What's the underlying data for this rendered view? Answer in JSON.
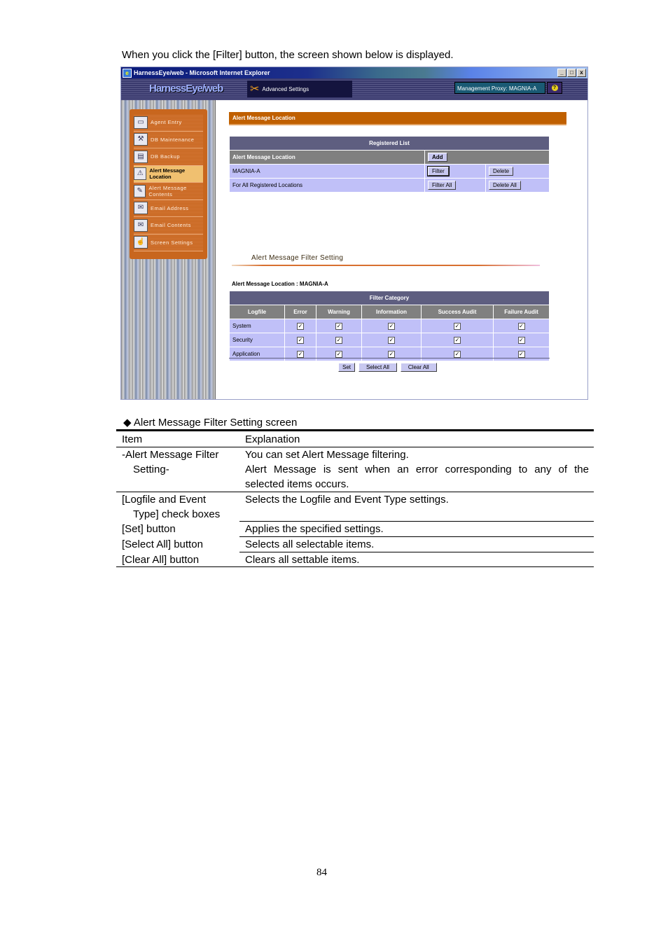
{
  "intro_text": "When you click the [Filter] button, the screen shown below is displayed.",
  "browser": {
    "title": "HarnessEye/web - Microsoft Internet Explorer",
    "window_buttons": [
      "_",
      "□",
      "x"
    ]
  },
  "app": {
    "logo": "HarnessEye/web",
    "mode_label": "Advanced Settings",
    "proxy_label": "Management Proxy: MAGNIA-A",
    "help_icon": "?"
  },
  "sidebar": {
    "items": [
      {
        "label": "Agent Entry",
        "icon": "agent-entry-icon",
        "active": false
      },
      {
        "label": "DB Maintenance",
        "icon": "db-maintenance-icon",
        "active": false
      },
      {
        "label": "DB Backup",
        "icon": "db-backup-icon",
        "active": false
      },
      {
        "label": "Alert Message Location",
        "icon": "alert-warning-icon",
        "active": true
      },
      {
        "label": "Alert Message Contents",
        "icon": "alert-contents-icon",
        "active": false
      },
      {
        "label": "Email Address",
        "icon": "email-address-icon",
        "active": false
      },
      {
        "label": "Email Contents",
        "icon": "email-contents-icon",
        "active": false
      },
      {
        "label": "Screen Settings",
        "icon": "screen-settings-icon",
        "active": false
      }
    ]
  },
  "main": {
    "section_title": "Alert Message Location",
    "registered_list": {
      "title": "Registered List",
      "header_label": "Alert Message Location",
      "add_button": "Add",
      "rows": [
        {
          "name": "MAGNIA-A",
          "filter_button": "Filter",
          "delete_button": "Delete"
        },
        {
          "name": "For All Registered Locations",
          "filter_button": "Filter All",
          "delete_button": "Delete All"
        }
      ]
    },
    "filter_setting": {
      "title": "Alert Message Filter Setting",
      "location_label": "Alert Message Location : MAGNIA-A",
      "category_title": "Filter Category",
      "columns": [
        "Logfile",
        "Error",
        "Warning",
        "Information",
        "Success Audit",
        "Failure Audit"
      ],
      "rows": [
        {
          "logfile": "System",
          "checked": [
            true,
            true,
            true,
            true,
            true
          ]
        },
        {
          "logfile": "Security",
          "checked": [
            true,
            true,
            true,
            true,
            true
          ]
        },
        {
          "logfile": "Application",
          "checked": [
            true,
            true,
            true,
            true,
            true
          ]
        }
      ],
      "buttons": {
        "set": "Set",
        "select_all": "Select All",
        "clear_all": "Clear All"
      }
    }
  },
  "doc": {
    "caption": "◆ Alert Message Filter Setting screen",
    "headers": {
      "item": "Item",
      "explanation": "Explanation"
    },
    "rows": [
      {
        "item": [
          "-Alert Message Filter",
          "Setting-"
        ],
        "explanation": [
          "You can set Alert Message filtering.",
          "Alert Message is sent when an error corresponding to any of the",
          "selected items occurs."
        ]
      },
      {
        "item": [
          "[Logfile and Event",
          "Type] check boxes"
        ],
        "explanation": [
          "Selects the Logfile and Event Type settings."
        ]
      },
      {
        "item": [
          "[Set] button"
        ],
        "explanation": [
          "Applies the specified settings."
        ]
      },
      {
        "item": [
          "[Select All] button"
        ],
        "explanation": [
          "Selects all selectable items."
        ]
      },
      {
        "item": [
          "[Clear All] button"
        ],
        "explanation": [
          "Clears all settable items."
        ]
      }
    ]
  },
  "page_number": "84"
}
